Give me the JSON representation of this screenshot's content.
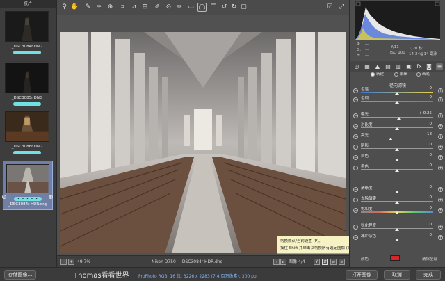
{
  "filmstrip": {
    "header": "胶片",
    "items": [
      {
        "name": "_DSC3084r.DNG",
        "selected": false
      },
      {
        "name": "_DSC3085r.DNG",
        "selected": false
      },
      {
        "name": "_DSC3086r.DNG",
        "selected": false
      },
      {
        "name": "_DSC3084r-HDR.dng",
        "selected": true,
        "rating": "• • • • •"
      }
    ]
  },
  "toolbar": {
    "tools": [
      "zoom-icon",
      "hand-icon",
      "white-balance-icon",
      "color-sampler-icon",
      "crop-icon",
      "straighten-icon",
      "transform-icon",
      "spot-removal-icon",
      "red-eye-icon",
      "adjustment-brush-icon",
      "graduated-filter-icon",
      "radial-filter-icon",
      "rotate-ccw-icon",
      "rotate-cw-icon",
      "trash-icon"
    ],
    "preview_label": "预览",
    "preview_glyph": "☑"
  },
  "status": {
    "zoom": "49.7%",
    "camera_file": "Nikon D750 - _DSC3084r-HDR.dng",
    "image_count": "图像 4/4"
  },
  "tooltip": {
    "line1": "切换默认/当前设置 (P)。",
    "line2": "按住 Shift 并单击以切换所有选定图像 (Shift-P)。"
  },
  "panel": {
    "info": {
      "r": "R:",
      "g": "G:",
      "b": "B:",
      "r_val": "---",
      "g_val": "---",
      "b_val": "---",
      "aperture": "f/11",
      "shutter": "1/20 秒",
      "iso": "ISO 100",
      "lens": "14-24@14 毫米"
    },
    "section_title": "径向滤镜",
    "modes": [
      "新建",
      "编辑",
      "画笔"
    ],
    "sliders": [
      {
        "label": "色温",
        "value": "0",
        "track": "temp",
        "pos": 0.5
      },
      {
        "label": "色调",
        "value": "0",
        "track": "tint",
        "pos": 0.5
      },
      {
        "label": "曝光",
        "value": "+ 0.25",
        "track": "plain",
        "pos": 0.53
      },
      {
        "label": "对比度",
        "value": "0",
        "track": "plain",
        "pos": 0.5
      },
      {
        "label": "高光",
        "value": "- 18",
        "track": "plain",
        "pos": 0.41
      },
      {
        "label": "阴影",
        "value": "0",
        "track": "plain",
        "pos": 0.5
      },
      {
        "label": "白色",
        "value": "0",
        "track": "plain",
        "pos": 0.5
      },
      {
        "label": "黑色",
        "value": "0",
        "track": "plain",
        "pos": 0.5
      },
      {
        "label": "清晰度",
        "value": "0",
        "track": "plain",
        "pos": 0.5
      },
      {
        "label": "去除薄雾",
        "value": "0",
        "track": "plain",
        "pos": 0.5
      },
      {
        "label": "饱和度",
        "value": "0",
        "track": "sat",
        "pos": 0.5
      },
      {
        "label": "锐化程度",
        "value": "0",
        "track": "plain",
        "pos": 0.5
      },
      {
        "label": "减少杂色",
        "value": "0",
        "track": "plain",
        "pos": 0.5
      }
    ],
    "bottom": {
      "color_label": "颜色",
      "clear_all": "清除全部",
      "swatch": "#d8252a"
    }
  },
  "bottom": {
    "save_button": "存储图像...",
    "brand": "Thomas看看世界",
    "workflow": "ProPhoto RGB; 16 位; 3226 x 2283 (7.4 百万像素); 300 ppi",
    "open_button": "打开图像",
    "cancel_button": "取消",
    "done_button": "完成"
  },
  "colors": {
    "accent_cyan": "#6fe0e4",
    "selection": "#6f7fa6",
    "tooltip_bg": "#f6f2c4"
  }
}
